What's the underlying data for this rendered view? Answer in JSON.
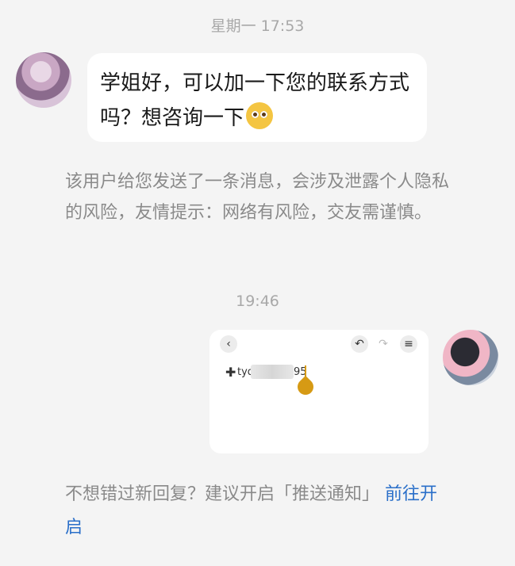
{
  "timestamps": {
    "first": "星期一 17:53",
    "second": "19:46"
  },
  "message_in": {
    "text": "学姐好，可以加一下您的联系方式吗？想咨询一下",
    "emoji": "pleading-face-emoji"
  },
  "privacy_notice": "该用户给您发送了一条消息，会涉及泄露个人隐私的风险，友情提示：网络有风险，交友需谨慎。",
  "image_message": {
    "toolbar_icons": [
      "back-icon",
      "undo-icon",
      "redo-icon",
      "menu-icon"
    ],
    "toolbar_glyphs": {
      "back": "‹",
      "undo": "↶",
      "redo": "↷",
      "menu": "≡"
    },
    "plus_glyph": "✚",
    "handle_prefix": "tyq",
    "handle_suffix": "95"
  },
  "footer": {
    "text": "不想错过新回复？建议开启「推送通知」",
    "link": "前往开启"
  },
  "colors": {
    "background": "#f4f4f4",
    "bubble": "#ffffff",
    "link": "#2a6fc9",
    "muted": "#8a8a8a",
    "cursor_handle": "#d69a14"
  }
}
